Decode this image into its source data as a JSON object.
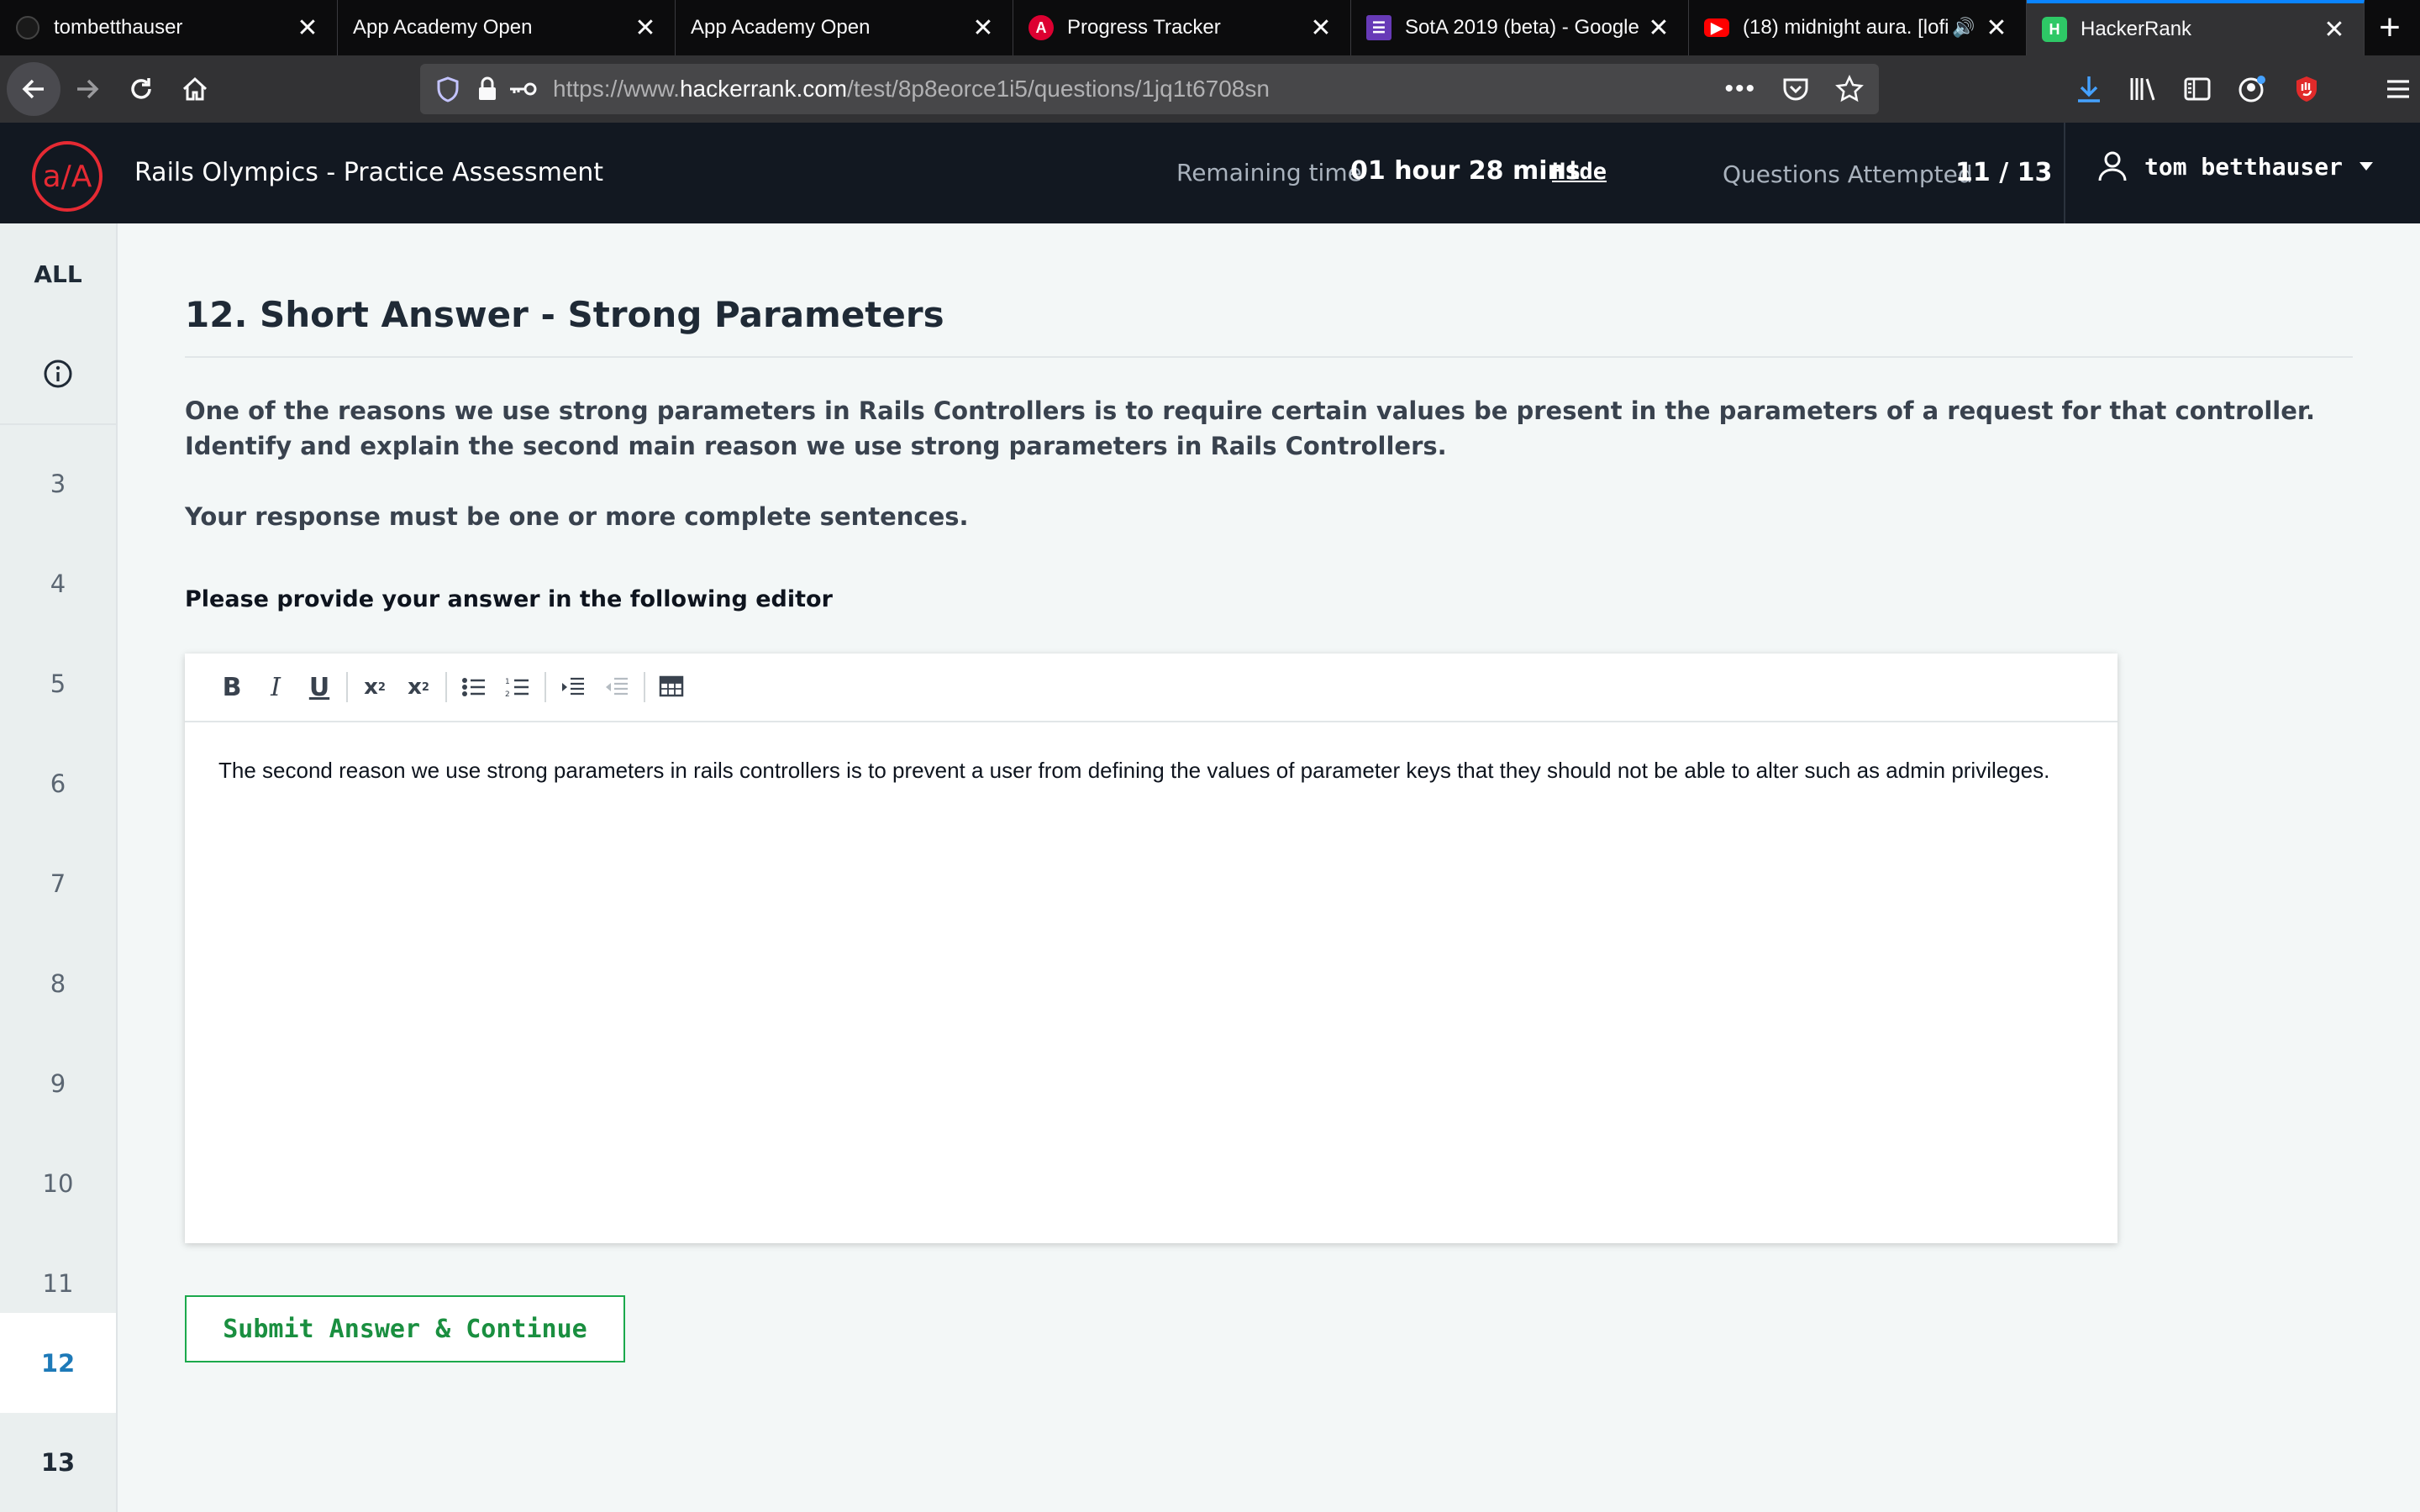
{
  "browser": {
    "tabs": [
      {
        "title": "tombetthauser",
        "favicon": "github-icon"
      },
      {
        "title": "App Academy Open",
        "favicon": "none"
      },
      {
        "title": "App Academy Open",
        "favicon": "none"
      },
      {
        "title": "Progress Tracker",
        "favicon": "angular-icon"
      },
      {
        "title": "SotA 2019 (beta) - Google",
        "favicon": "google-forms-icon"
      },
      {
        "title": "(18) midnight aura. [lofi",
        "favicon": "youtube-icon"
      },
      {
        "title": "HackerRank",
        "favicon": "hackerrank-icon"
      }
    ],
    "url_prefix": "https://www.",
    "url_host": "hackerrank.com",
    "url_path": "/test/8p8eorce1i5/questions/1jq1t6708sn"
  },
  "header": {
    "logo_text": "a/A",
    "title": "Rails Olympics - Practice Assessment",
    "remaining_label": "Remaining time",
    "remaining_value": "01 hour 28 mins",
    "hide_label": "Hide",
    "attempted_label": "Questions Attempted",
    "attempted_value": "11 / 13",
    "user_name": "tom betthauser"
  },
  "sidebar": {
    "all_label": "ALL",
    "items": [
      "3",
      "4",
      "5",
      "6",
      "7",
      "8",
      "9",
      "10",
      "11",
      "12",
      "13"
    ],
    "current": "12"
  },
  "question": {
    "title": "12. Short Answer - Strong Parameters",
    "body_1": "One of the reasons we use strong parameters in Rails Controllers is to require certain values be present in the parameters of a request for that controller.  Identify and explain the second main reason we use strong parameters in Rails Controllers.",
    "body_2": "Your response must be one or more complete sentences.",
    "prompt": "Please provide your answer in the following editor"
  },
  "editor": {
    "answer": "The second reason we use strong parameters in rails controllers is to prevent a user from defining the values of parameter keys that they should not be able to alter such as admin privileges."
  },
  "actions": {
    "submit_label": "Submit Answer & Continue"
  },
  "colors": {
    "header_bg": "#121821",
    "logo_red": "#e62a33",
    "accent_green": "#1ba94c",
    "current_blue": "#1e7ab8"
  }
}
